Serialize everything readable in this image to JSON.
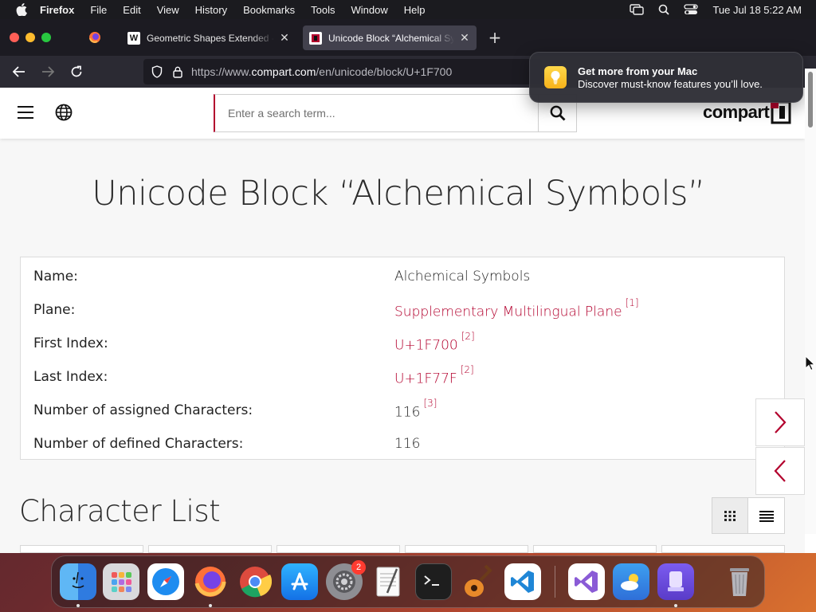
{
  "menubar": {
    "app_name": "Firefox",
    "items": [
      "File",
      "Edit",
      "View",
      "History",
      "Bookmarks",
      "Tools",
      "Window",
      "Help"
    ],
    "clock": "Tue Jul 18  5:22 AM"
  },
  "tabs": [
    {
      "title": "Geometric Shapes Extended - W",
      "favicon": "wikipedia-icon"
    },
    {
      "title": "Unicode Block “Alchemical Symbols”",
      "favicon": "compart-icon",
      "active": true
    }
  ],
  "navbar": {
    "url_prefix": "https://www.",
    "url_domain": "compart.com",
    "url_path": "/en/unicode/block/U+1F700"
  },
  "notification": {
    "title": "Get more from your Mac",
    "subtitle": "Discover must-know features you’ll love."
  },
  "site": {
    "search_placeholder": "Enter a search term...",
    "logo_text": "compart",
    "heading": "Unicode Block “Alchemical Symbols”",
    "info": [
      {
        "label": "Name:",
        "value": "Alchemical Symbols",
        "link": false,
        "ref": ""
      },
      {
        "label": "Plane:",
        "value": "Supplementary Multilingual Plane",
        "link": true,
        "ref": "[1]"
      },
      {
        "label": "First Index:",
        "value": "U+1F700",
        "link": true,
        "ref": "[2]"
      },
      {
        "label": "Last Index:",
        "value": "U+1F77F",
        "link": true,
        "ref": "[2]"
      },
      {
        "label": "Number of assigned Characters:",
        "value": "116",
        "link": false,
        "ref": "[3]"
      },
      {
        "label": "Number of defined Characters:",
        "value": "116",
        "link": false,
        "ref": ""
      }
    ],
    "character_list_title": "Character List"
  },
  "dock": {
    "apps": [
      "Finder",
      "Launchpad",
      "Safari",
      "Firefox",
      "Chrome",
      "App Store",
      "System Settings",
      "TextEdit",
      "Terminal",
      "GarageBand",
      "Visual Studio Code",
      "Visual Studio",
      "Weather",
      "Simulator",
      "Trash"
    ],
    "system_settings_badge": "2"
  },
  "colors": {
    "accent": "#b3002d",
    "menubar_bg": "#1b1b1f",
    "tabbar_bg": "#1c1b22",
    "navbar_bg": "#2b2a33"
  }
}
